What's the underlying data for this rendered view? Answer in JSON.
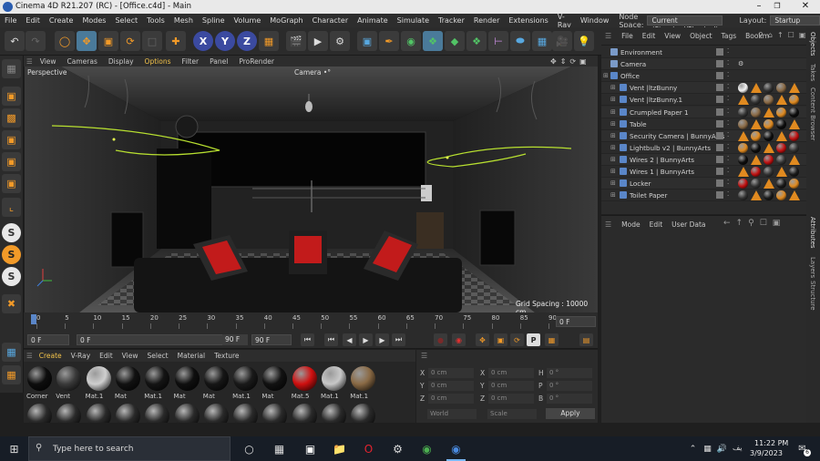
{
  "window": {
    "title": "Cinema 4D R21.207 (RC) - [Office.c4d] - Main",
    "controls": {
      "minimize": "–",
      "restore": "❐",
      "close": "✕"
    }
  },
  "menubar": {
    "items": [
      "File",
      "Edit",
      "Create",
      "Modes",
      "Select",
      "Tools",
      "Mesh",
      "Spline",
      "Volume",
      "MoGraph",
      "Character",
      "Animate",
      "Simulate",
      "Tracker",
      "Render",
      "Extensions",
      "V-Ray",
      "Window"
    ],
    "node_space_label": "Node Space:",
    "node_space_value": "Current (Standard/Physical)",
    "layout_label": "Layout:",
    "layout_value": "Startup"
  },
  "viewport": {
    "menu": [
      "View",
      "Cameras",
      "Display",
      "Options",
      "Filter",
      "Panel",
      "ProRender"
    ],
    "label": "Perspective",
    "camera": "Camera •°",
    "grid_spacing": "Grid Spacing : 10000 cm"
  },
  "timeline": {
    "ticks": [
      "0",
      "5",
      "10",
      "15",
      "20",
      "25",
      "30",
      "35",
      "40",
      "45",
      "50",
      "55",
      "60",
      "65",
      "70",
      "75",
      "80",
      "85",
      "90"
    ],
    "end_frame": "0 F",
    "current_frame_field": "0 F",
    "start_field": "0 F",
    "max_field": "90 F",
    "max_field2": "90 F"
  },
  "materials": {
    "menu": [
      "Create",
      "V-Ray",
      "Edit",
      "View",
      "Select",
      "Material",
      "Texture"
    ],
    "items": [
      {
        "name": "Corner",
        "color": "#0d0d0d"
      },
      {
        "name": "Vent",
        "color": "#3a3a3a"
      },
      {
        "name": "Mat.1",
        "color": "#cfcfcf"
      },
      {
        "name": "Mat",
        "color": "#111111"
      },
      {
        "name": "Mat.1",
        "color": "#141414"
      },
      {
        "name": "Mat",
        "color": "#0f0f0f"
      },
      {
        "name": "Mat",
        "color": "#161616"
      },
      {
        "name": "Mat.1",
        "color": "#1a1a1a"
      },
      {
        "name": "Mat",
        "color": "#121212"
      },
      {
        "name": "Mat.5",
        "color": "#d01010"
      },
      {
        "name": "Mat.1",
        "color": "#c8c8c8"
      },
      {
        "name": "Mat.1",
        "color": "#8a6a45"
      }
    ]
  },
  "coordinates": {
    "labels": [
      "X",
      "Y",
      "Z",
      "X",
      "Y",
      "Z",
      "H",
      "P",
      "B"
    ],
    "values": [
      "0 cm",
      "0 cm",
      "0 cm",
      "0 cm",
      "0 cm",
      "0 cm",
      "0 °",
      "0 °",
      "0 °"
    ],
    "mode1": "World",
    "mode2": "Scale",
    "apply": "Apply"
  },
  "objects": {
    "menu": [
      "File",
      "Edit",
      "View",
      "Object",
      "Tags",
      "Bookm"
    ],
    "items": [
      {
        "name": "Environment",
        "indent": 0
      },
      {
        "name": "Camera",
        "indent": 0
      },
      {
        "name": "Office",
        "indent": 0
      },
      {
        "name": "Vent |ltzBunny",
        "indent": 1
      },
      {
        "name": "Vent |ltzBunny.1",
        "indent": 1
      },
      {
        "name": "Crumpled Paper 1",
        "indent": 1
      },
      {
        "name": "Table",
        "indent": 1
      },
      {
        "name": "Security Camera | BunnyArts",
        "indent": 1
      },
      {
        "name": "Lightbulb v2 | BunnyArts",
        "indent": 1
      },
      {
        "name": "Wires 2 | BunnyArts",
        "indent": 1
      },
      {
        "name": "Wires 1 | BunnyArts",
        "indent": 1
      },
      {
        "name": "Locker",
        "indent": 1
      },
      {
        "name": "Toilet Paper",
        "indent": 1
      }
    ]
  },
  "attributes": {
    "menu": [
      "Mode",
      "Edit",
      "User Data"
    ]
  },
  "side_tabs": [
    "Objects",
    "Takes",
    "Content Browser",
    "Attributes",
    "Layers",
    "Structure"
  ],
  "taskbar": {
    "search_placeholder": "Type here to search",
    "time": "11:22 PM",
    "date": "3/9/2023",
    "lang": "یف",
    "notif_count": "6"
  },
  "colors": {
    "accent_orange": "#f29a28",
    "wire_green": "#b8e030",
    "axis_blue": "#3b4aa0"
  }
}
